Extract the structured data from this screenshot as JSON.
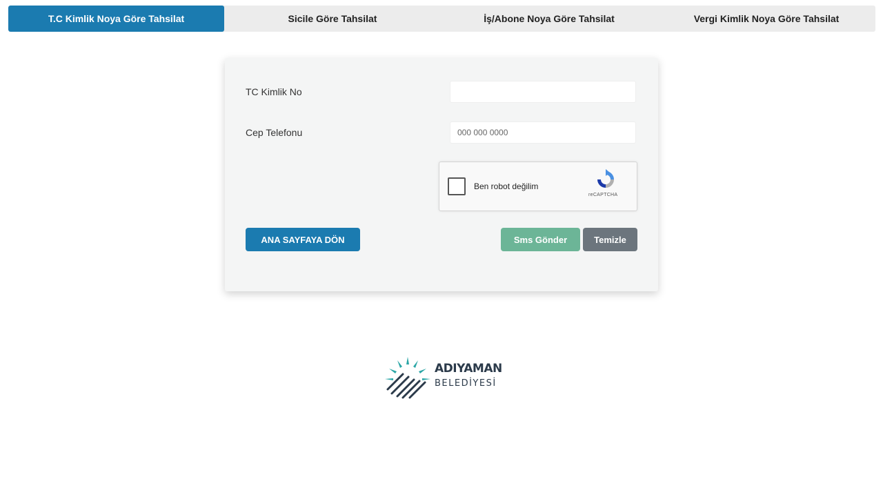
{
  "tabs": [
    {
      "label": "T.C Kimlik Noya Göre Tahsilat",
      "active": true
    },
    {
      "label": "Sicile Göre Tahsilat",
      "active": false
    },
    {
      "label": "İş/Abone Noya Göre Tahsilat",
      "active": false
    },
    {
      "label": "Vergi Kimlik Noya Göre Tahsilat",
      "active": false
    }
  ],
  "form": {
    "tc_label": "TC Kimlik No",
    "tc_value": "",
    "tc_placeholder": "",
    "phone_label": "Cep Telefonu",
    "phone_value": "",
    "phone_placeholder": "000 000 0000"
  },
  "recaptcha": {
    "label": "Ben robot değilim",
    "brand": "reCAPTCHA",
    "checked": false
  },
  "buttons": {
    "home": "ANA SAYFAYA DÖN",
    "sms": "Sms Gönder",
    "clear": "Temizle"
  },
  "logo": {
    "title": "ADIYAMAN",
    "subtitle": "BELEDİYESİ"
  },
  "colors": {
    "primary": "#1b7bb0",
    "success": "#6cb597",
    "secondary": "#6c757d",
    "tab_bg": "#ececec",
    "card_bg": "#f4f5f5",
    "logo_teal": "#2ba6a6",
    "logo_dark": "#2b3a4a"
  }
}
